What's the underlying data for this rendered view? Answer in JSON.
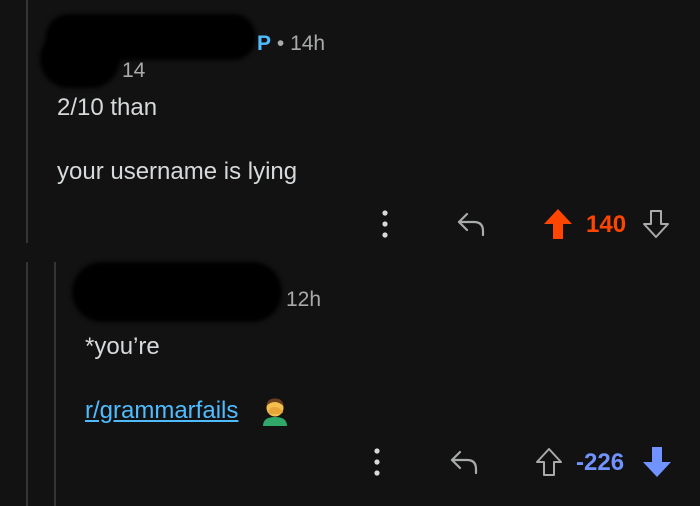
{
  "comment1": {
    "op_badge": "P",
    "separator": "•",
    "age": "14h",
    "flair": "14",
    "line1": "2/10 than",
    "line2": "your username is lying",
    "score": "140",
    "vote_state": "upvoted",
    "colors": {
      "upvote": "#ff4500"
    }
  },
  "comment2": {
    "age": "12h",
    "line1": "*you’re",
    "link": "r/grammarfails",
    "emoji": "facepalm",
    "score": "-226",
    "vote_state": "downvoted",
    "colors": {
      "downvote": "#7193ff"
    }
  },
  "icons": {
    "more": "more-vertical-icon",
    "reply": "reply-arrow-icon",
    "upvote": "upvote-arrow-icon",
    "downvote": "downvote-arrow-icon"
  }
}
